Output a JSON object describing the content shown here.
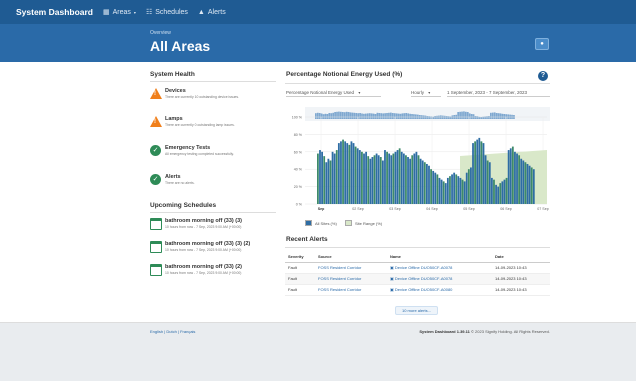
{
  "nav": {
    "brand": "System Dashboard",
    "areas_label": "Areas",
    "schedules_label": "Schedules",
    "alerts_label": "Alerts"
  },
  "banner": {
    "eyebrow": "Overview",
    "title": "All Areas"
  },
  "health": {
    "heading": "System Health",
    "items": [
      {
        "title": "Devices",
        "desc": "There are currently 10 outstanding device issues.",
        "status": "warning"
      },
      {
        "title": "Lamps",
        "desc": "There are currently 0 outstanding lamp issues.",
        "status": "warning"
      },
      {
        "title": "Emergency Tests",
        "desc": "All emergency testing completed successfully.",
        "status": "ok"
      },
      {
        "title": "Alerts",
        "desc": "There are no alerts.",
        "status": "ok"
      }
    ]
  },
  "schedules": {
    "heading": "Upcoming Schedules",
    "items": [
      {
        "title": "bathroom morning off (33) (3)",
        "desc": "10 hours from now - 7 Sep, 2023 9:00 AM (+00:00)"
      },
      {
        "title": "bathroom morning off (33) (3) (2)",
        "desc": "10 hours from now - 7 Sep, 2023 9:00 AM (+00:00)"
      },
      {
        "title": "bathroom morning off (33) (2)",
        "desc": "10 hours from now - 7 Sep, 2023 9:00 AM (+00:00)"
      }
    ]
  },
  "energy": {
    "heading": "Percentage Notional Energy Used (%)",
    "metric_select": "Percentage Notional Energy Used",
    "interval_select": "Hourly",
    "date_range": "1 September, 2023 - 7 September, 2023"
  },
  "chart_data": {
    "type": "bar",
    "title": "",
    "ylim": [
      0,
      100
    ],
    "yticks": [
      "0 %",
      "20 %",
      "40 %",
      "60 %",
      "80 %",
      "100 %"
    ],
    "xticks": [
      "Sep",
      "02 Sep",
      "03 Sep",
      "04 Sep",
      "05 Sep",
      "06 Sep",
      "07 Sep"
    ],
    "series": [
      {
        "name": "All Sites (%)",
        "color": "#2e6da4"
      },
      {
        "name": "Site Range (%)",
        "color": "#d9e8c9"
      }
    ],
    "all_sites_values": [
      58,
      62,
      60,
      55,
      48,
      52,
      50,
      60,
      58,
      62,
      70,
      72,
      74,
      72,
      70,
      68,
      72,
      70,
      66,
      64,
      62,
      60,
      58,
      60,
      55,
      52,
      54,
      56,
      58,
      56,
      54,
      50,
      62,
      60,
      58,
      56,
      58,
      60,
      62,
      64,
      60,
      58,
      56,
      54,
      52,
      56,
      58,
      60,
      56,
      52,
      50,
      48,
      46,
      44,
      40,
      38,
      36,
      34,
      30,
      28,
      26,
      24,
      30,
      32,
      34,
      36,
      34,
      32,
      30,
      28,
      26,
      36,
      40,
      42,
      70,
      72,
      74,
      76,
      72,
      70,
      56,
      50,
      48,
      30,
      28,
      22,
      20,
      24,
      26,
      28,
      30,
      62,
      64,
      66,
      60,
      58,
      56,
      52,
      50,
      48,
      46,
      44,
      42,
      40
    ],
    "site_range_max": 62
  },
  "alerts": {
    "heading": "Recent Alerts",
    "columns": [
      "Severity",
      "Source",
      "Name",
      "Date"
    ],
    "rows": [
      {
        "severity": "Fault",
        "source": "FOSS Resident Corridor",
        "name": "Device Offline DUO50CF-A0078",
        "date": "14-09-2023 10:43"
      },
      {
        "severity": "Fault",
        "source": "FOSS Resident Corridor",
        "name": "Device Offline DUO50CF-A0078",
        "date": "14-09-2023 10:43"
      },
      {
        "severity": "Fault",
        "source": "FOSS Resident Corridor",
        "name": "Device Offline DUO50CF-A0080",
        "date": "14-09-2023 10:43"
      }
    ],
    "more_label": "10 more alerts..."
  },
  "footer": {
    "languages": "English | Dutch | Français",
    "product": "System Dashboard 1.39.11",
    "copyright": "© 2023 Signify Holding. All Rights Reserved."
  },
  "colors": {
    "nav": "#1f5b93",
    "banner": "#2a6aa8",
    "warning": "#f07f1b",
    "ok": "#2e8b57",
    "bar": "#2e6da4",
    "range": "#d9e8c9"
  }
}
